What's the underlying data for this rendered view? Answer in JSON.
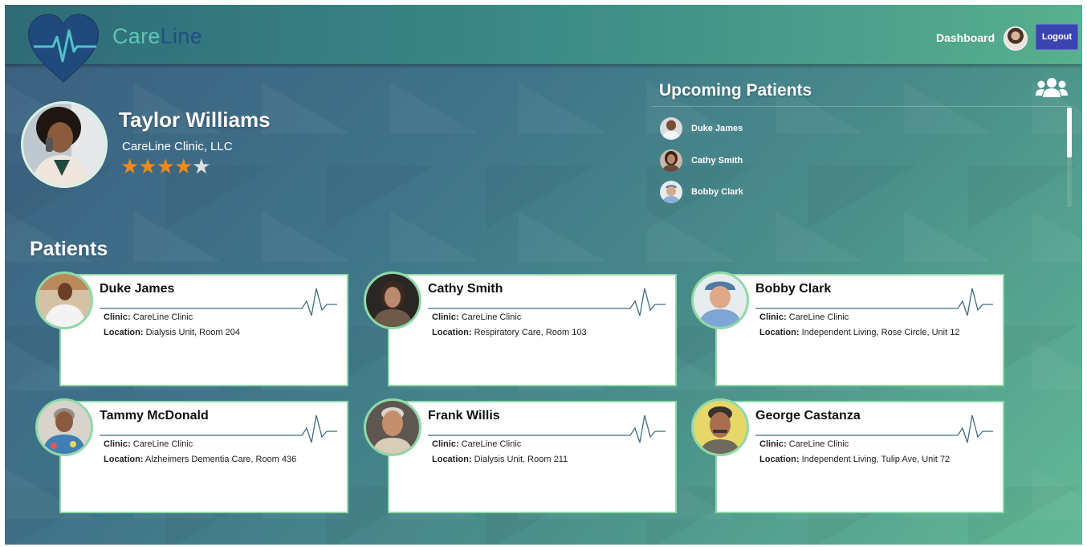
{
  "header": {
    "brand_care": "Care",
    "brand_line": "Line",
    "nav_dashboard": "Dashboard",
    "logout_label": "Logout"
  },
  "profile": {
    "name": "Taylor Williams",
    "clinic": "CareLine Clinic, LLC",
    "rating": 4,
    "rating_max": 5
  },
  "upcoming": {
    "title": "Upcoming Patients",
    "icon": "users-icon",
    "items": [
      {
        "name": "Duke James"
      },
      {
        "name": "Cathy Smith"
      },
      {
        "name": "Bobby Clark"
      }
    ]
  },
  "patients": {
    "title": "Patients",
    "clinic_label": "Clinic:",
    "location_label": "Location:",
    "cards": [
      {
        "name": "Duke James",
        "clinic": "CareLine Clinic",
        "location": "Dialysis Unit, Room 204"
      },
      {
        "name": "Cathy Smith",
        "clinic": "CareLine Clinic",
        "location": "Respiratory Care, Room 103"
      },
      {
        "name": "Bobby Clark",
        "clinic": "CareLine Clinic",
        "location": "Independent Living, Rose Circle, Unit 12"
      },
      {
        "name": "Tammy McDonald",
        "clinic": "CareLine Clinic",
        "location": "Alzheimers Dementia Care, Room 436"
      },
      {
        "name": "Frank Willis",
        "clinic": "CareLine Clinic",
        "location": "Dialysis Unit, Room 211"
      },
      {
        "name": "George Castanza",
        "clinic": "CareLine Clinic",
        "location": "Independent Living, Tulip Ave, Unit 72"
      }
    ]
  },
  "colors": {
    "accent_green": "#8fd9a8",
    "logout_bg": "#3b43b0",
    "star_on": "#f18a17",
    "brand_care": "#5cc7b6",
    "brand_line": "#1f4d85"
  }
}
